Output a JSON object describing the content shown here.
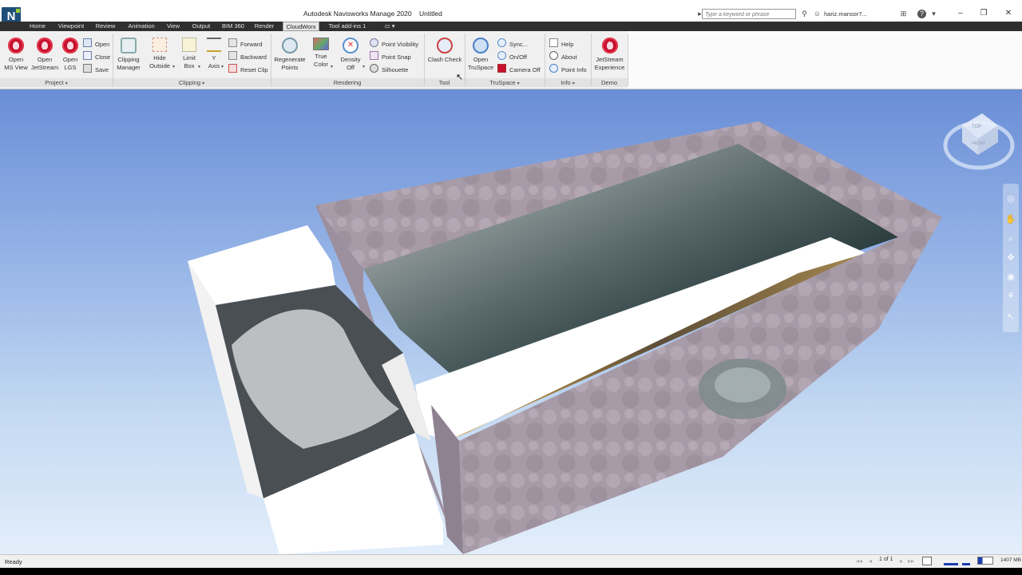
{
  "window": {
    "title": "Autodesk Navisworks Manage 2020    Untitled",
    "search_placeholder": "Type a keyword or phrase",
    "user": "hariz.mansor7...",
    "app_logo": "N"
  },
  "tabs": [
    {
      "label": "Home"
    },
    {
      "label": "Viewpoint"
    },
    {
      "label": "Review"
    },
    {
      "label": "Animation"
    },
    {
      "label": "View"
    },
    {
      "label": "Output"
    },
    {
      "label": "BIM 360"
    },
    {
      "label": "Render"
    },
    {
      "label": "CloudWorx"
    },
    {
      "label": "Tool add-ins 1"
    }
  ],
  "active_tab": "CloudWorx",
  "ribbon": {
    "project": {
      "label": "Project",
      "open_ms_view": [
        "Open",
        "MS View"
      ],
      "open_jetstream": [
        "Open",
        "JetStream"
      ],
      "open_lgs": [
        "Open",
        "LGS"
      ],
      "open": "Open",
      "close": "Close",
      "save": "Save"
    },
    "clipping": {
      "label": "Clipping",
      "clipping_manager": [
        "Clipping",
        "Manager"
      ],
      "hide_outside": [
        "Hide",
        "Outside"
      ],
      "limit_box": [
        "Limit",
        "Box"
      ],
      "y_axis": [
        "Y",
        "Axis"
      ],
      "forward": "Forward",
      "backward": "Backward",
      "reset_clip": "Reset Clip"
    },
    "rendering": {
      "label": "Rendering",
      "regenerate_points": [
        "Regenerate",
        "Points"
      ],
      "true_color": [
        "True",
        "Color"
      ],
      "density_off": [
        "Density",
        "Off"
      ],
      "point_visibility": "Point Visibility",
      "point_snap": "Point Snap",
      "silhouette": "Silhouette"
    },
    "tool": {
      "label": "Tool",
      "clash_check": "Clash Check"
    },
    "truspace": {
      "label": "TruSpace",
      "open_truspace": [
        "Open",
        "TruSpace"
      ],
      "sync": "Sync...",
      "on_off": "On/Off",
      "camera_off": "Camera Off"
    },
    "info": {
      "label": "Info",
      "help": "Help",
      "about": "About",
      "point_info": "Point Info"
    },
    "demo": {
      "label": "Demo",
      "jetstream_experience": [
        "JetStream",
        "Experience"
      ]
    }
  },
  "viewcube": {
    "top": "TOP",
    "front": "FRONT"
  },
  "status": {
    "text": "Ready",
    "page": "1 of 1",
    "memory": "1407 MB"
  },
  "colors": {
    "accent_red": "#c8102e",
    "tab_active": "#e6e6e6",
    "viewport_top": "#6a8ed6",
    "viewport_bottom": "#e3eefb"
  }
}
